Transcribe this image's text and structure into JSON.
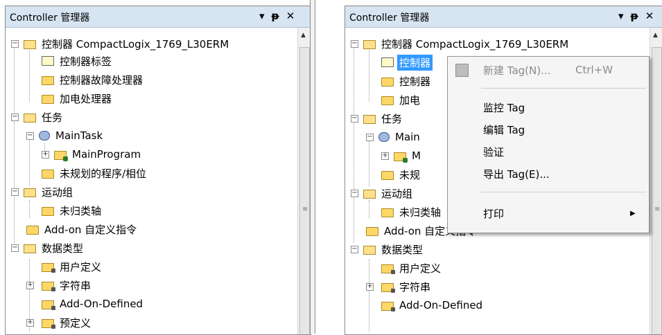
{
  "panels": [
    {
      "title": "Controller 管理器",
      "tree": [
        {
          "label": "控制器 CompactLogix_1769_L30ERM",
          "icon": "folder-open-icon"
        },
        {
          "label": "控制器标签",
          "icon": "tag-icon"
        },
        {
          "label": "控制器故障处理器",
          "icon": "folder-icon"
        },
        {
          "label": "加电处理器",
          "icon": "folder-icon"
        },
        {
          "label": "任务",
          "icon": "folder-open-icon"
        },
        {
          "label": "MainTask",
          "icon": "task-icon"
        },
        {
          "label": "MainProgram",
          "icon": "program-icon"
        },
        {
          "label": "未规划的程序/相位",
          "icon": "folder-icon"
        },
        {
          "label": "运动组",
          "icon": "folder-open-icon"
        },
        {
          "label": "未归类轴",
          "icon": "folder-icon"
        },
        {
          "label": "Add-on 自定义指令",
          "icon": "folder-icon"
        },
        {
          "label": "数据类型",
          "icon": "folder-open-icon"
        },
        {
          "label": "用户定义",
          "icon": "datatype-icon"
        },
        {
          "label": "字符串",
          "icon": "datatype-icon"
        },
        {
          "label": "Add-On-Defined",
          "icon": "datatype-icon"
        },
        {
          "label": "预定义",
          "icon": "datatype-icon"
        }
      ]
    },
    {
      "title": "Controller 管理器",
      "tree": [
        {
          "label": "控制器 CompactLogix_1769_L30ERM",
          "icon": "folder-open-icon"
        },
        {
          "label": "控制器",
          "icon": "tag-icon",
          "selected": true
        },
        {
          "label": "控制器",
          "icon": "folder-icon"
        },
        {
          "label": "加电",
          "icon": "folder-icon"
        },
        {
          "label": "任务",
          "icon": "folder-open-icon"
        },
        {
          "label": "Main",
          "icon": "task-icon"
        },
        {
          "label": "M",
          "icon": "program-icon"
        },
        {
          "label": "未规",
          "icon": "folder-icon"
        },
        {
          "label": "运动组",
          "icon": "folder-open-icon"
        },
        {
          "label": "未归类轴",
          "icon": "folder-icon"
        },
        {
          "label": "Add-on 自定义指令",
          "icon": "folder-icon"
        },
        {
          "label": "数据类型",
          "icon": "folder-open-icon"
        },
        {
          "label": "用户定义",
          "icon": "datatype-icon"
        },
        {
          "label": "字符串",
          "icon": "datatype-icon"
        },
        {
          "label": "Add-On-Defined",
          "icon": "datatype-icon"
        }
      ]
    }
  ],
  "titlebar_icons": [
    "▾",
    "ᵽ",
    "✕"
  ],
  "context_menu": {
    "items": [
      {
        "label": "新建 Tag(N)...",
        "shortcut": "Ctrl+W",
        "disabled": true
      },
      {
        "label": "监控 Tag"
      },
      {
        "label": "编辑 Tag"
      },
      {
        "label": "验证"
      },
      {
        "label": "导出 Tag(E)..."
      },
      {
        "label": "打印",
        "submenu_arrow": "▶"
      }
    ]
  },
  "colors": {
    "titlebar": "#d7e4f2",
    "selection": "#3399ff",
    "menu_bg": "#f5f5f5"
  }
}
